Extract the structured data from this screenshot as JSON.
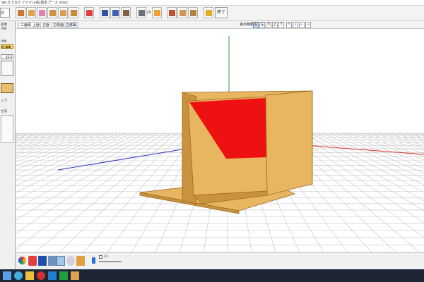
{
  "window": {
    "title": "Ver.5.3.0.0 ファイル名[基本ブース.xlsx]"
  },
  "toolbar": {
    "left_field": "p",
    "num_label": "24",
    "end_label": "終了"
  },
  "left_panel": {
    "labels": [
      "変更",
      "/5M",
      "/5M",
      "材-編集",
      "ップ",
      "寸法"
    ],
    "value_field": "45.0"
  },
  "view_tabs": [
    "三面図",
    "上面",
    "正面",
    "右側面",
    "立体図"
  ],
  "view_mode_label": "視点移動",
  "view_buttons": [
    "右",
    "左",
    "下",
    "上",
    "T"
  ],
  "view_arrows": [
    "↑",
    "↓",
    "←",
    "→"
  ],
  "scene": {
    "colors": {
      "wood": "#e8b560",
      "wood_dark": "#c9923d",
      "wood_edge": "#9c6a22",
      "red_panel": "#ee1111",
      "grid": "#c4c4c4",
      "axis_x": "#e03030",
      "axis_y": "#2e9a3e",
      "axis_z": "#2a3ac0"
    }
  },
  "bottom_strip": {
    "check_label": "24"
  }
}
